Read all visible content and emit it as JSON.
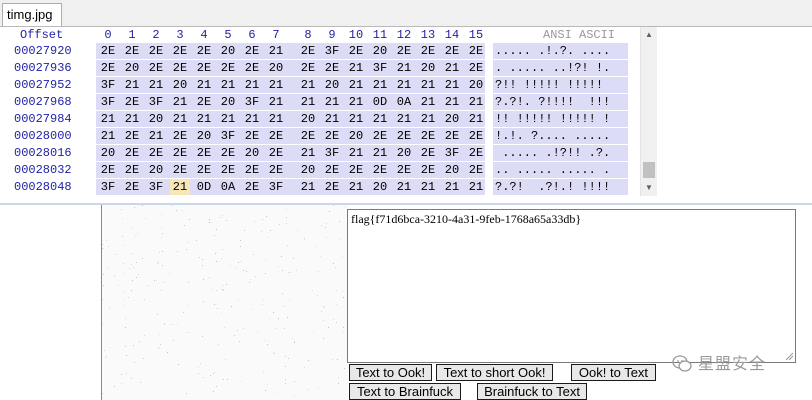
{
  "window": {
    "tab_title": "timg.jpg"
  },
  "hex_view": {
    "offset_header": "Offset",
    "column_headers": [
      "0",
      "1",
      "2",
      "3",
      "4",
      "5",
      "6",
      "7",
      "8",
      "9",
      "10",
      "11",
      "12",
      "13",
      "14",
      "15"
    ],
    "ascii_header": "ANSI ASCII",
    "rows": [
      {
        "offset": "00027920",
        "bytes": [
          "2E",
          "2E",
          "2E",
          "2E",
          "2E",
          "20",
          "2E",
          "21",
          "2E",
          "3F",
          "2E",
          "20",
          "2E",
          "2E",
          "2E",
          "2E"
        ],
        "ascii": "..... .!.?. ...."
      },
      {
        "offset": "00027936",
        "bytes": [
          "2E",
          "20",
          "2E",
          "2E",
          "2E",
          "2E",
          "2E",
          "20",
          "2E",
          "2E",
          "21",
          "3F",
          "21",
          "20",
          "21",
          "2E"
        ],
        "ascii": ". ..... ..!?! !."
      },
      {
        "offset": "00027952",
        "bytes": [
          "3F",
          "21",
          "21",
          "20",
          "21",
          "21",
          "21",
          "21",
          "21",
          "20",
          "21",
          "21",
          "21",
          "21",
          "21",
          "20"
        ],
        "ascii": "?!! !!!!! !!!!! "
      },
      {
        "offset": "00027968",
        "bytes": [
          "3F",
          "2E",
          "3F",
          "21",
          "2E",
          "20",
          "3F",
          "21",
          "21",
          "21",
          "21",
          "0D",
          "0A",
          "21",
          "21",
          "21"
        ],
        "ascii": "?.?!. ?!!!!  !!!"
      },
      {
        "offset": "00027984",
        "bytes": [
          "21",
          "21",
          "20",
          "21",
          "21",
          "21",
          "21",
          "21",
          "20",
          "21",
          "21",
          "21",
          "21",
          "21",
          "20",
          "21"
        ],
        "ascii": "!! !!!!! !!!!! !"
      },
      {
        "offset": "00028000",
        "bytes": [
          "21",
          "2E",
          "21",
          "2E",
          "20",
          "3F",
          "2E",
          "2E",
          "2E",
          "2E",
          "20",
          "2E",
          "2E",
          "2E",
          "2E",
          "2E"
        ],
        "ascii": "!.!. ?.... ....."
      },
      {
        "offset": "00028016",
        "bytes": [
          "20",
          "2E",
          "2E",
          "2E",
          "2E",
          "2E",
          "20",
          "2E",
          "21",
          "3F",
          "21",
          "21",
          "20",
          "2E",
          "3F",
          "2E"
        ],
        "ascii": " ..... .!?!! .?."
      },
      {
        "offset": "00028032",
        "bytes": [
          "2E",
          "2E",
          "20",
          "2E",
          "2E",
          "2E",
          "2E",
          "2E",
          "20",
          "2E",
          "2E",
          "2E",
          "2E",
          "2E",
          "20",
          "2E"
        ],
        "ascii": ".. ..... ..... ."
      },
      {
        "offset": "00028048",
        "bytes": [
          "3F",
          "2E",
          "3F",
          "21",
          "0D",
          "0A",
          "2E",
          "3F",
          "21",
          "2E",
          "21",
          "20",
          "21",
          "21",
          "21",
          "21"
        ],
        "ascii": "?.?!  .?!.! !!!!"
      }
    ]
  },
  "converter": {
    "output_text": "flag{f71d6bca-3210-4a31-9feb-1768a65a33db}",
    "buttons": {
      "text_to_ook": "Text to Ook!",
      "text_to_short_ook": "Text to short Ook!",
      "ook_to_text": "Ook! to Text",
      "text_to_brainfuck": "Text to Brainfuck",
      "brainfuck_to_text": "Brainfuck to Text"
    }
  },
  "watermark": {
    "text": "星盟安全",
    "icon": "wechat-icon"
  },
  "colors": {
    "header_blue": "#1f1fa8",
    "selection_band": "#dcdcf6"
  }
}
